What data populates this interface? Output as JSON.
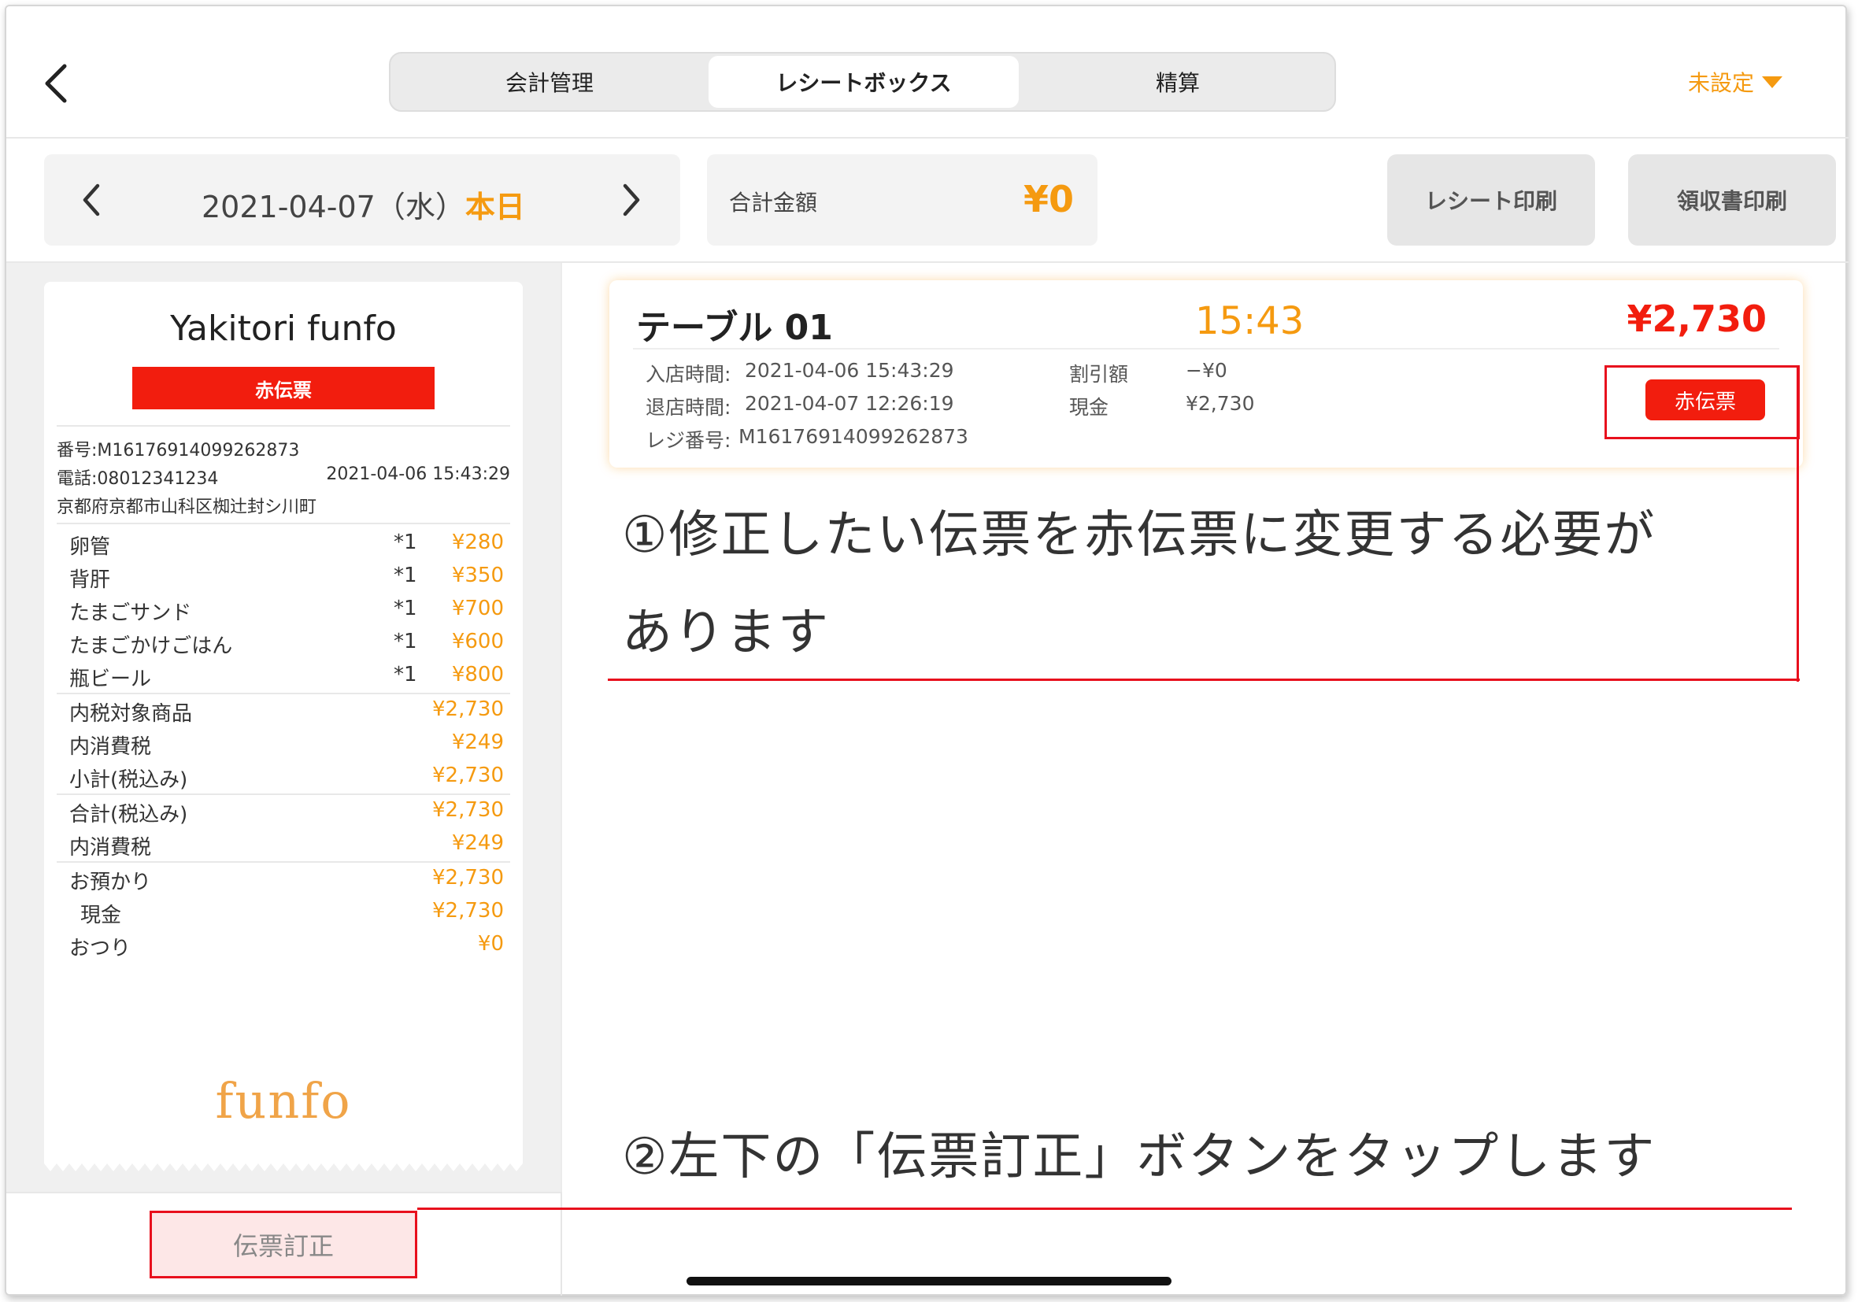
{
  "header": {
    "tabs": [
      {
        "label": "会計管理",
        "active": false
      },
      {
        "label": "レシートボックス",
        "active": true
      },
      {
        "label": "精算",
        "active": false
      }
    ],
    "unset_label": "未設定"
  },
  "toolbar": {
    "date": "2021-04-07（水）",
    "today": "本日",
    "total_label": "合計金額",
    "total_value": "¥0",
    "receipt_print": "レシート印刷",
    "invoice_print": "領収書印刷"
  },
  "receipt": {
    "shop_name": "Yakitori funfo",
    "red_label": "赤伝票",
    "number": "番号:M16176914099262873",
    "phone": "電話:08012341234",
    "datetime": "2021-04-06 15:43:29",
    "address": "京都府京都市山科区椥辻封シ川町",
    "items": [
      {
        "name": "卵管",
        "qty": "*1",
        "price": "¥280"
      },
      {
        "name": "背肝",
        "qty": "*1",
        "price": "¥350"
      },
      {
        "name": "たまごサンド",
        "qty": "*1",
        "price": "¥700"
      },
      {
        "name": "たまごかけごはん",
        "qty": "*1",
        "price": "¥600"
      },
      {
        "name": "瓶ビール",
        "qty": "*1",
        "price": "¥800"
      }
    ],
    "summary": [
      {
        "name": "内税対象商品",
        "price": "¥2,730"
      },
      {
        "name": "内消費税",
        "price": "¥249"
      },
      {
        "name": "小計(税込み)",
        "price": "¥2,730"
      },
      {
        "name": "合計(税込み)",
        "price": "¥2,730"
      },
      {
        "name": "内消費税",
        "price": "¥249"
      },
      {
        "name": "お預かり",
        "price": "¥2,730"
      },
      {
        "name": "現金",
        "price": "¥2,730"
      },
      {
        "name": "おつり",
        "price": "¥0"
      }
    ],
    "logo": "funfo",
    "correction_button": "伝票訂正"
  },
  "card": {
    "table": "テーブル 01",
    "time": "15:43",
    "total": "¥2,730",
    "entry_label": "入店時間:",
    "entry_value": "2021-04-06 15:43:29",
    "exit_label": "退店時間:",
    "exit_value": "2021-04-07 12:26:19",
    "register_label": "レジ番号:",
    "register_value": "M16176914099262873",
    "discount_label": "割引額",
    "discount_value": "−¥0",
    "cash_label": "現金",
    "cash_value": "¥2,730",
    "red_button": "赤伝票"
  },
  "notes": {
    "note1_line1": "①修正したい伝票を赤伝票に変更する必要が",
    "note1_line2": "あります",
    "note2": "②左下の「伝票訂正」ボタンをタップします"
  },
  "colors": {
    "accent": "#f59a10",
    "red": "#f21d0e",
    "annotation_red": "#e8101d"
  }
}
